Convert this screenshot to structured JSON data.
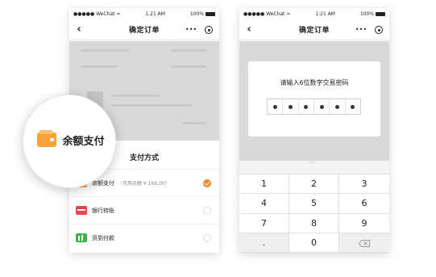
{
  "left_phone": {
    "statusbar": {
      "carrier": "●●●●● WeChat",
      "signal_glyph": "≈",
      "time": "1:21 AM",
      "battery": "100%"
    },
    "navbar": {
      "title": "确定订单",
      "more_glyph": "•••"
    },
    "sheet": {
      "title": "支付方式",
      "options": [
        {
          "label": "余额支付",
          "hint": "（可用余额 ¥ 168.00）",
          "selected": true
        },
        {
          "label": "银行转账",
          "selected": false
        },
        {
          "label": "货到付款",
          "selected": false
        }
      ]
    },
    "magnifier": {
      "label": "余额支付",
      "icon": "wallet-icon"
    }
  },
  "right_phone": {
    "statusbar": {
      "carrier": "●●●●● WeChat",
      "signal_glyph": "≈",
      "time": "1:21 AM",
      "battery": "100%"
    },
    "navbar": {
      "title": "确定订单",
      "more_glyph": "•••"
    },
    "password_dialog": {
      "title": "请输入6位数字交易密码",
      "digits_entered": 6
    },
    "keypad": {
      "keys": [
        "1",
        "2",
        "3",
        "4",
        "5",
        "6",
        "7",
        "8",
        "9",
        ".",
        "0",
        "⌫"
      ]
    }
  },
  "colors": {
    "accent": "#f7882f",
    "bank": "#e8434b",
    "cod": "#3fb14a",
    "wallet": "#f7a23b"
  }
}
